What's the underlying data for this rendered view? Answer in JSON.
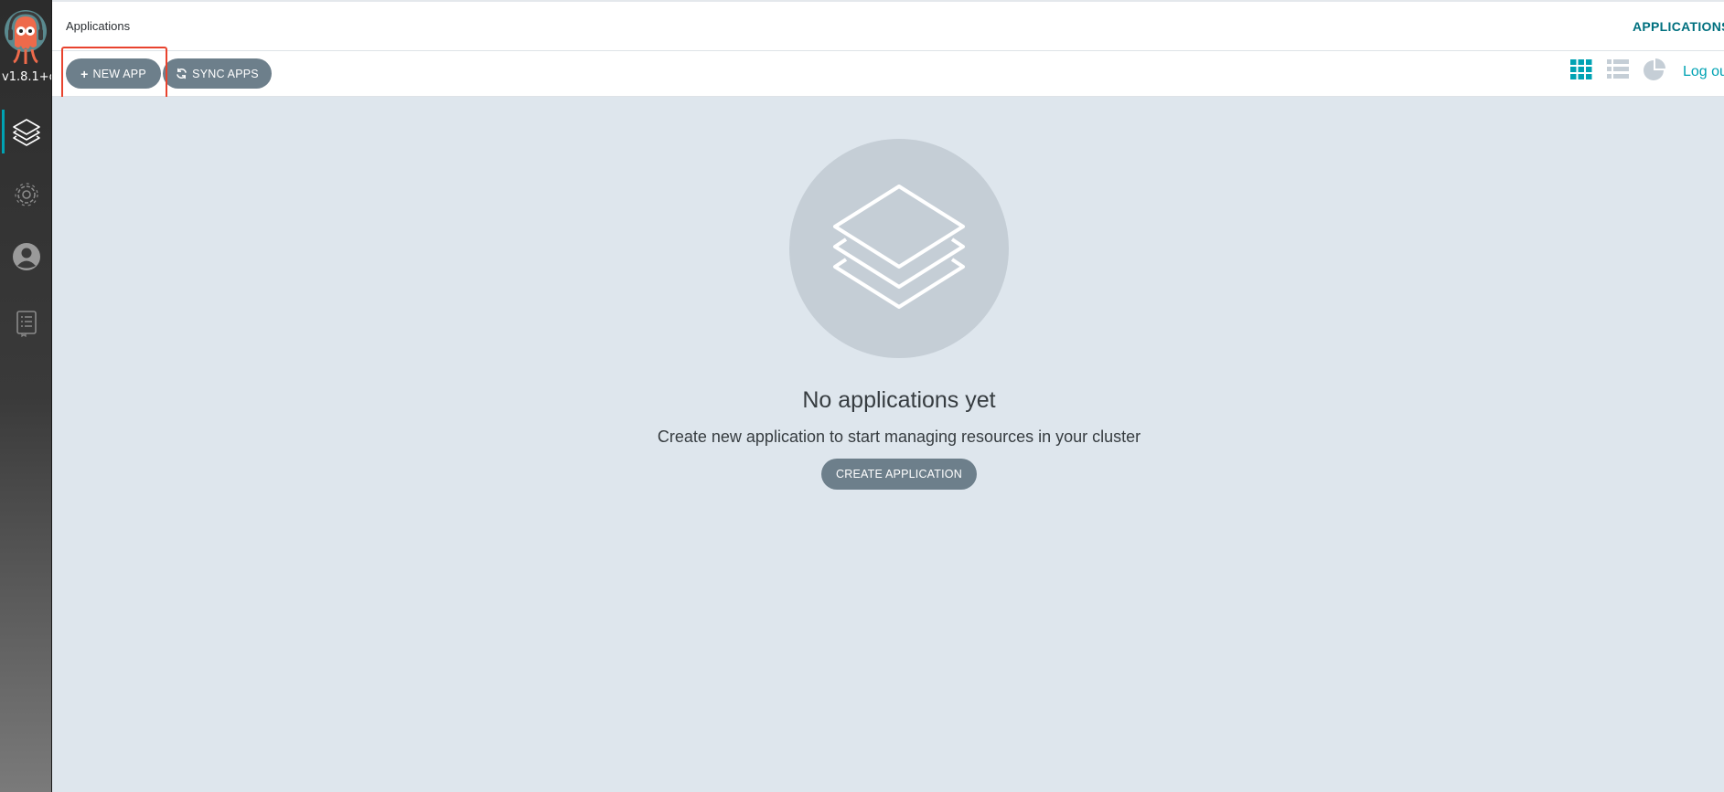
{
  "sidebar": {
    "version": "v1.8.1+c",
    "items": [
      {
        "name": "applications",
        "icon": "layers-icon",
        "active": true
      },
      {
        "name": "settings",
        "icon": "gear-icon",
        "active": false
      },
      {
        "name": "user-info",
        "icon": "user-icon",
        "active": false
      },
      {
        "name": "documentation",
        "icon": "docs-icon",
        "active": false
      }
    ]
  },
  "header": {
    "title": "Applications",
    "right_title": "APPLICATIONS"
  },
  "toolbar": {
    "new_app_label": "NEW APP",
    "sync_apps_label": "SYNC APPS",
    "view_icons": [
      "tiles-view-icon",
      "list-view-icon",
      "summary-view-icon"
    ],
    "logout_label": "Log out"
  },
  "empty_state": {
    "title": "No applications yet",
    "subtitle": "Create new application to start managing resources in your cluster",
    "button_label": "CREATE APPLICATION"
  },
  "colors": {
    "accent": "#00a2b3",
    "button": "#6d7f8b",
    "content_bg": "#dee6ed",
    "highlight": "#e8432e"
  }
}
